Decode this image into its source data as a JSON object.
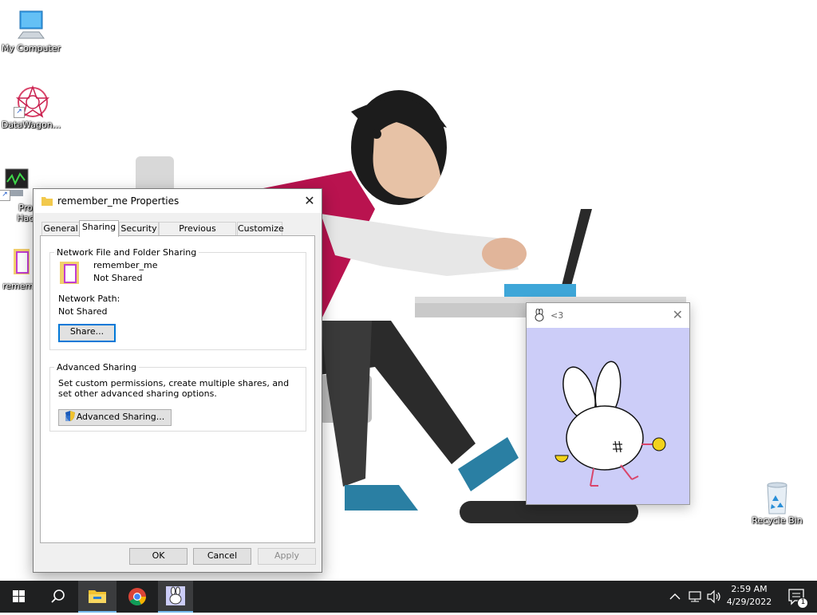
{
  "desktop": {
    "icons": [
      {
        "label": "My Computer"
      },
      {
        "label": "DataWagon..."
      },
      {
        "label": "Proc Hack"
      },
      {
        "label": "remem"
      },
      {
        "label": "Recycle Bin"
      }
    ]
  },
  "properties_dialog": {
    "title": "remember_me Properties",
    "tabs": [
      "General",
      "Sharing",
      "Security",
      "Previous Versions",
      "Customize"
    ],
    "active_tab": "Sharing",
    "network_sharing": {
      "legend": "Network File and Folder Sharing",
      "folder_name": "remember_me",
      "status": "Not Shared",
      "path_label": "Network Path:",
      "path_value": "Not Shared",
      "share_button": "Share..."
    },
    "advanced_sharing": {
      "legend": "Advanced Sharing",
      "description": "Set custom permissions, create multiple shares, and set other advanced sharing options.",
      "button": "Advanced Sharing..."
    },
    "buttons": {
      "ok": "OK",
      "cancel": "Cancel",
      "apply": "Apply"
    }
  },
  "pet_window": {
    "title": "<3",
    "background_color": "#cccdf8"
  },
  "taskbar": {
    "time": "2:59 AM",
    "date": "4/29/2022",
    "notification_count": "1",
    "pinned": [
      "start-icon",
      "search-icon",
      "file-explorer-icon",
      "chrome-icon",
      "bunny-app-icon"
    ]
  },
  "colors": {
    "accent": "#0078d7",
    "taskbar": "#1f2021"
  }
}
